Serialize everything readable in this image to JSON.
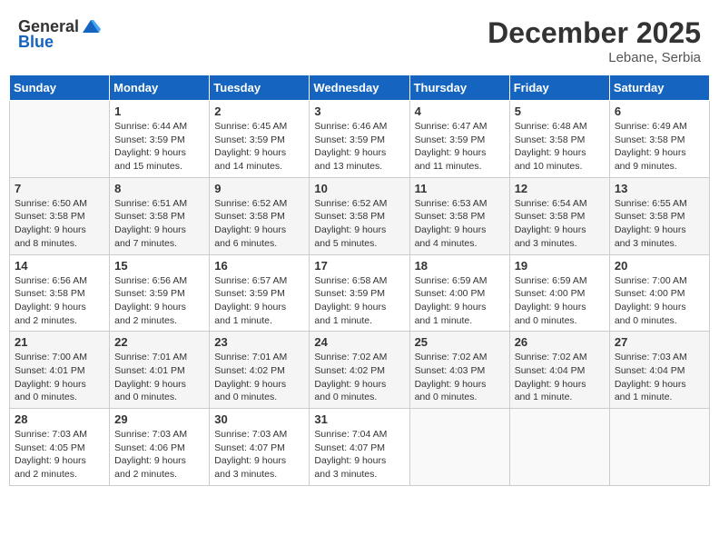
{
  "header": {
    "logo_general": "General",
    "logo_blue": "Blue",
    "month_year": "December 2025",
    "location": "Lebane, Serbia"
  },
  "days_of_week": [
    "Sunday",
    "Monday",
    "Tuesday",
    "Wednesday",
    "Thursday",
    "Friday",
    "Saturday"
  ],
  "weeks": [
    [
      {
        "day": "",
        "info": ""
      },
      {
        "day": "1",
        "info": "Sunrise: 6:44 AM\nSunset: 3:59 PM\nDaylight: 9 hours\nand 15 minutes."
      },
      {
        "day": "2",
        "info": "Sunrise: 6:45 AM\nSunset: 3:59 PM\nDaylight: 9 hours\nand 14 minutes."
      },
      {
        "day": "3",
        "info": "Sunrise: 6:46 AM\nSunset: 3:59 PM\nDaylight: 9 hours\nand 13 minutes."
      },
      {
        "day": "4",
        "info": "Sunrise: 6:47 AM\nSunset: 3:59 PM\nDaylight: 9 hours\nand 11 minutes."
      },
      {
        "day": "5",
        "info": "Sunrise: 6:48 AM\nSunset: 3:58 PM\nDaylight: 9 hours\nand 10 minutes."
      },
      {
        "day": "6",
        "info": "Sunrise: 6:49 AM\nSunset: 3:58 PM\nDaylight: 9 hours\nand 9 minutes."
      }
    ],
    [
      {
        "day": "7",
        "info": "Sunrise: 6:50 AM\nSunset: 3:58 PM\nDaylight: 9 hours\nand 8 minutes."
      },
      {
        "day": "8",
        "info": "Sunrise: 6:51 AM\nSunset: 3:58 PM\nDaylight: 9 hours\nand 7 minutes."
      },
      {
        "day": "9",
        "info": "Sunrise: 6:52 AM\nSunset: 3:58 PM\nDaylight: 9 hours\nand 6 minutes."
      },
      {
        "day": "10",
        "info": "Sunrise: 6:52 AM\nSunset: 3:58 PM\nDaylight: 9 hours\nand 5 minutes."
      },
      {
        "day": "11",
        "info": "Sunrise: 6:53 AM\nSunset: 3:58 PM\nDaylight: 9 hours\nand 4 minutes."
      },
      {
        "day": "12",
        "info": "Sunrise: 6:54 AM\nSunset: 3:58 PM\nDaylight: 9 hours\nand 3 minutes."
      },
      {
        "day": "13",
        "info": "Sunrise: 6:55 AM\nSunset: 3:58 PM\nDaylight: 9 hours\nand 3 minutes."
      }
    ],
    [
      {
        "day": "14",
        "info": "Sunrise: 6:56 AM\nSunset: 3:58 PM\nDaylight: 9 hours\nand 2 minutes."
      },
      {
        "day": "15",
        "info": "Sunrise: 6:56 AM\nSunset: 3:59 PM\nDaylight: 9 hours\nand 2 minutes."
      },
      {
        "day": "16",
        "info": "Sunrise: 6:57 AM\nSunset: 3:59 PM\nDaylight: 9 hours\nand 1 minute."
      },
      {
        "day": "17",
        "info": "Sunrise: 6:58 AM\nSunset: 3:59 PM\nDaylight: 9 hours\nand 1 minute."
      },
      {
        "day": "18",
        "info": "Sunrise: 6:59 AM\nSunset: 4:00 PM\nDaylight: 9 hours\nand 1 minute."
      },
      {
        "day": "19",
        "info": "Sunrise: 6:59 AM\nSunset: 4:00 PM\nDaylight: 9 hours\nand 0 minutes."
      },
      {
        "day": "20",
        "info": "Sunrise: 7:00 AM\nSunset: 4:00 PM\nDaylight: 9 hours\nand 0 minutes."
      }
    ],
    [
      {
        "day": "21",
        "info": "Sunrise: 7:00 AM\nSunset: 4:01 PM\nDaylight: 9 hours\nand 0 minutes."
      },
      {
        "day": "22",
        "info": "Sunrise: 7:01 AM\nSunset: 4:01 PM\nDaylight: 9 hours\nand 0 minutes."
      },
      {
        "day": "23",
        "info": "Sunrise: 7:01 AM\nSunset: 4:02 PM\nDaylight: 9 hours\nand 0 minutes."
      },
      {
        "day": "24",
        "info": "Sunrise: 7:02 AM\nSunset: 4:02 PM\nDaylight: 9 hours\nand 0 minutes."
      },
      {
        "day": "25",
        "info": "Sunrise: 7:02 AM\nSunset: 4:03 PM\nDaylight: 9 hours\nand 0 minutes."
      },
      {
        "day": "26",
        "info": "Sunrise: 7:02 AM\nSunset: 4:04 PM\nDaylight: 9 hours\nand 1 minute."
      },
      {
        "day": "27",
        "info": "Sunrise: 7:03 AM\nSunset: 4:04 PM\nDaylight: 9 hours\nand 1 minute."
      }
    ],
    [
      {
        "day": "28",
        "info": "Sunrise: 7:03 AM\nSunset: 4:05 PM\nDaylight: 9 hours\nand 2 minutes."
      },
      {
        "day": "29",
        "info": "Sunrise: 7:03 AM\nSunset: 4:06 PM\nDaylight: 9 hours\nand 2 minutes."
      },
      {
        "day": "30",
        "info": "Sunrise: 7:03 AM\nSunset: 4:07 PM\nDaylight: 9 hours\nand 3 minutes."
      },
      {
        "day": "31",
        "info": "Sunrise: 7:04 AM\nSunset: 4:07 PM\nDaylight: 9 hours\nand 3 minutes."
      },
      {
        "day": "",
        "info": ""
      },
      {
        "day": "",
        "info": ""
      },
      {
        "day": "",
        "info": ""
      }
    ]
  ]
}
